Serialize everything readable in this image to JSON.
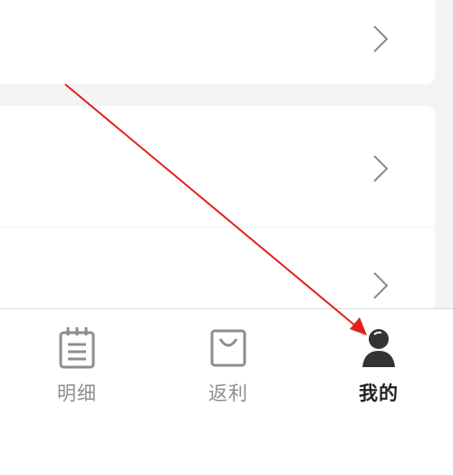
{
  "list": {
    "rows": [
      {
        "chevron_icon": "chevron-right-icon"
      },
      {
        "chevron_icon": "chevron-right-icon"
      },
      {
        "chevron_icon": "chevron-right-icon"
      }
    ]
  },
  "tabbar": {
    "tabs": [
      {
        "label": "明细",
        "icon": "notepad-icon",
        "active": false
      },
      {
        "label": "返利",
        "icon": "shopping-bag-icon",
        "active": false
      },
      {
        "label": "我的",
        "icon": "person-icon",
        "active": true
      }
    ]
  },
  "annotation": {
    "type": "arrow",
    "color": "#e0201b"
  },
  "colors": {
    "background": "#f4f4f4",
    "card": "#ffffff",
    "inactive_tab": "#8e8e8e",
    "active_tab": "#222222",
    "chevron": "#8a8a8a"
  }
}
